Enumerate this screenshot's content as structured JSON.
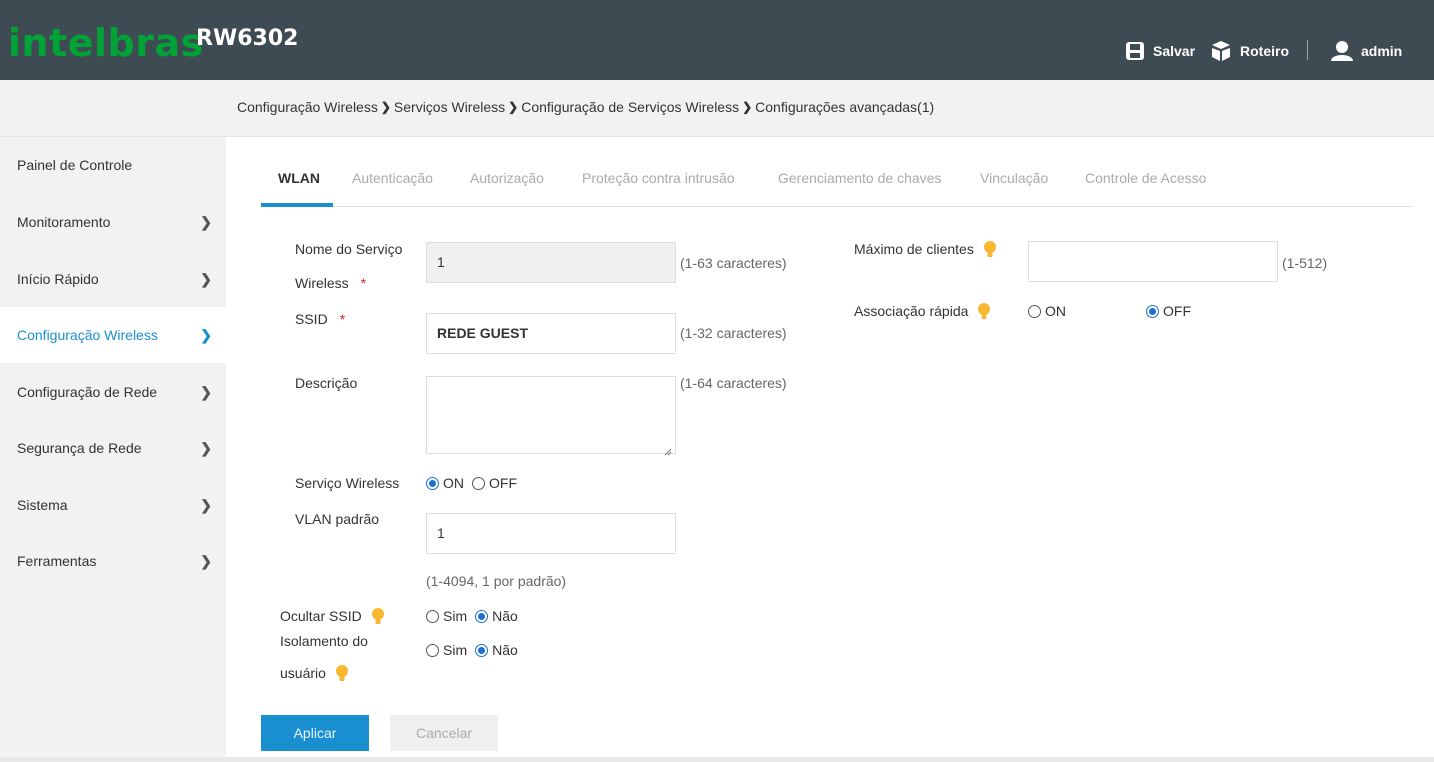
{
  "header": {
    "brand": "intelbras",
    "model": "RW6302",
    "save_label": "Salvar",
    "guide_label": "Roteiro",
    "user_label": "admin",
    "brand_color": "#00a335",
    "bg_color": "#3f4b52"
  },
  "breadcrumb": [
    "Configuração Wireless",
    "Serviços Wireless",
    "Configuração de Serviços Wireless",
    "Configurações avançadas(1)"
  ],
  "sidebar": {
    "items": [
      {
        "label": "Painel de Controle",
        "chevron": false
      },
      {
        "label": "Monitoramento",
        "chevron": true
      },
      {
        "label": "Início Rápido",
        "chevron": true
      },
      {
        "label": "Configuração Wireless",
        "chevron": true,
        "active": true
      },
      {
        "label": "Configuração de Rede",
        "chevron": true
      },
      {
        "label": "Segurança de Rede",
        "chevron": true
      },
      {
        "label": "Sistema",
        "chevron": true
      },
      {
        "label": "Ferramentas",
        "chevron": true
      }
    ]
  },
  "tabs": [
    "WLAN",
    "Autenticação",
    "Autorização",
    "Proteção contra intrusão",
    "Gerenciamento de chaves",
    "Vinculação",
    "Controle de Acesso"
  ],
  "form": {
    "service_name": {
      "label_line1": "Nome do Serviço",
      "label_line2": "Wireless",
      "value": "1",
      "hint": "(1-63 caracteres)"
    },
    "ssid": {
      "label": "SSID",
      "value": "REDE GUEST",
      "hint": "(1-32 caracteres)"
    },
    "description": {
      "label": "Descrição",
      "value": "",
      "hint": "(1-64 caracteres)"
    },
    "wireless_service": {
      "label": "Serviço Wireless",
      "on": "ON",
      "off": "OFF",
      "selected": "ON"
    },
    "default_vlan": {
      "label": "VLAN padrão",
      "value": "1",
      "hint": "(1-4094, 1 por padrão)"
    },
    "hide_ssid": {
      "label": "Ocultar SSID",
      "yes": "Sim",
      "no": "Não",
      "selected": "Não"
    },
    "user_isolation": {
      "label_line1": "Isolamento do",
      "label_line2": "usuário",
      "yes": "Sim",
      "no": "Não",
      "selected": "Não"
    },
    "max_clients": {
      "label": "Máximo de clientes",
      "value": "",
      "hint": "(1-512)"
    },
    "fast_association": {
      "label": "Associação rápida",
      "on": "ON",
      "off": "OFF",
      "selected": "OFF"
    },
    "required_mark": "*"
  },
  "buttons": {
    "apply": "Aplicar",
    "cancel": "Cancelar"
  },
  "colors": {
    "accent": "#1a8fd0",
    "bulb": "#f7b731",
    "required": "#e02020"
  }
}
